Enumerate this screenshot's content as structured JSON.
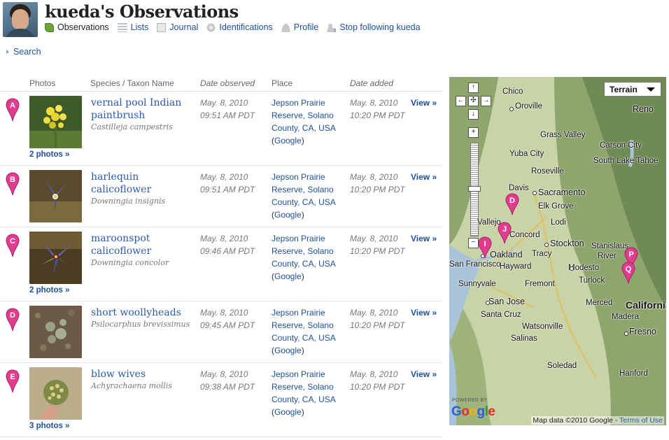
{
  "header": {
    "title": "kueda's Observations",
    "nav": [
      {
        "label": "Observations",
        "icon": "observations-icon"
      },
      {
        "label": "Lists",
        "icon": "lists-icon"
      },
      {
        "label": "Journal",
        "icon": "journal-icon"
      },
      {
        "label": "Identifications",
        "icon": "identifications-icon"
      },
      {
        "label": "Profile",
        "icon": "profile-icon"
      },
      {
        "label": "Stop following kueda",
        "icon": "unfollow-icon"
      }
    ]
  },
  "search": {
    "label": "Search"
  },
  "table": {
    "headers": {
      "photos": "Photos",
      "species": "Species / Taxon Name",
      "date_observed": "Date observed",
      "place": "Place",
      "date_added": "Date added"
    },
    "rows": [
      {
        "marker": "A",
        "common_name": "vernal pool Indian paintbrush",
        "scientific_name": "Castilleja campestris",
        "photo_count": "2 photos »",
        "observed_date": "May. 8, 2010",
        "observed_time": "09:51 AM PDT",
        "place": "Jepson Prairie Reserve, Solano County, CA, USA",
        "place_link": "Google",
        "added_date": "May. 8, 2010",
        "added_time": "10:20 PM PDT",
        "view": "View »"
      },
      {
        "marker": "B",
        "common_name": "harlequin calicoflower",
        "scientific_name": "Downingia insignis",
        "photo_count": "",
        "observed_date": "May. 8, 2010",
        "observed_time": "09:51 AM PDT",
        "place": "Jepson Prairie Reserve, Solano County, CA, USA",
        "place_link": "Google",
        "added_date": "May. 8, 2010",
        "added_time": "10:20 PM PDT",
        "view": "View »"
      },
      {
        "marker": "C",
        "common_name": "maroonspot calicoflower",
        "scientific_name": "Downingia concolor",
        "photo_count": "2 photos »",
        "observed_date": "May. 8, 2010",
        "observed_time": "09:46 AM PDT",
        "place": "Jepson Prairie Reserve, Solano County, CA, USA",
        "place_link": "Google",
        "added_date": "May. 8, 2010",
        "added_time": "10:20 PM PDT",
        "view": "View »"
      },
      {
        "marker": "D",
        "common_name": "short woollyheads",
        "scientific_name": "Psilocarphus brevissimus",
        "photo_count": "",
        "observed_date": "May. 8, 2010",
        "observed_time": "09:45 AM PDT",
        "place": "Jepson Prairie Reserve, Solano County, CA, USA",
        "place_link": "Google",
        "added_date": "May. 8, 2010",
        "added_time": "10:20 PM PDT",
        "view": "View »"
      },
      {
        "marker": "E",
        "common_name": "blow wives",
        "scientific_name": "Achyrachaena mollis",
        "photo_count": "3 photos »",
        "observed_date": "May. 8, 2010",
        "observed_time": "09:38 AM PDT",
        "place": "Jepson Prairie Reserve, Solano County, CA, USA",
        "place_link": "Google",
        "added_date": "May. 8, 2010",
        "added_time": "10:20 PM PDT",
        "view": "View »"
      }
    ]
  },
  "map": {
    "type_selector": "Terrain",
    "pan_controls": [
      "↑",
      "←",
      "✣",
      "→",
      "↓"
    ],
    "zoom_in": "+",
    "zoom_out": "−",
    "labels": [
      "Chico",
      "Oroville",
      "Reno",
      "Grass Valley",
      "Carson City",
      "South Lake Tahoe",
      "Yuba City",
      "Roseville",
      "Davis",
      "Sacramento",
      "Elk Grove",
      "Lodi",
      "Stockton",
      "Concord",
      "Vallejo",
      "Oakland",
      "Tracy",
      "Stanislaus",
      "River",
      "Hayward",
      "Modesto",
      "Turlock",
      "Fremont",
      "Sunnyvale",
      "San Jose",
      "Merced",
      "California",
      "Santa Cruz",
      "Madera",
      "Watsonville",
      "Fresno",
      "Salinas",
      "Hanford",
      "Soledad",
      "San Francisco"
    ],
    "markers": [
      "D",
      "J",
      "I",
      "P",
      "Q"
    ],
    "powered_by": "POWERED BY",
    "logo": "Google",
    "attribution": "Map data ©2010 Google -",
    "terms": "Terms of Use"
  },
  "colors": {
    "link": "#1e4f9a",
    "marker": "#e23c8f",
    "title": "#222222"
  }
}
